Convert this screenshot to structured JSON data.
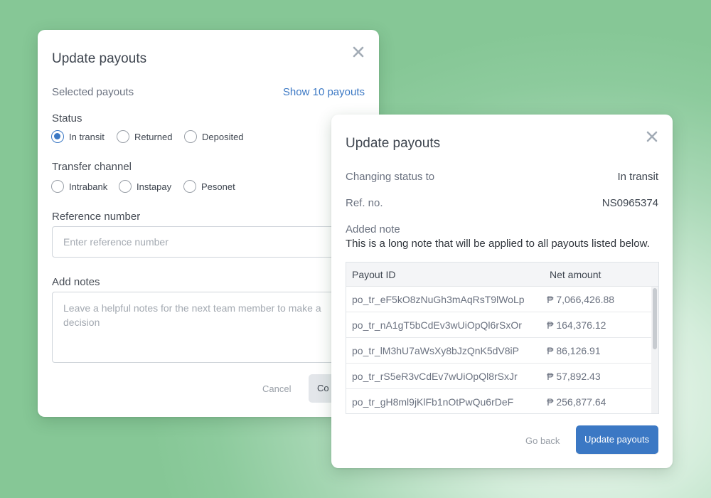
{
  "back_modal": {
    "title": "Update payouts",
    "selected_label": "Selected payouts",
    "show_link": "Show 10 payouts",
    "status_label": "Status",
    "status_options": [
      "In transit",
      "Returned",
      "Deposited"
    ],
    "status_selected": "In transit",
    "channel_label": "Transfer channel",
    "channel_options": [
      "Intrabank",
      "Instapay",
      "Pesonet"
    ],
    "reference_label": "Reference number",
    "reference_placeholder": "Enter reference number",
    "notes_label": "Add notes",
    "notes_placeholder": "Leave a helpful notes for the next team member to make a decision",
    "cancel_label": "Cancel",
    "confirm_label_visible": "Co"
  },
  "front_modal": {
    "title": "Update payouts",
    "changing_label": "Changing status to",
    "changing_value": "In transit",
    "ref_label": "Ref. no.",
    "ref_value": "NS0965374",
    "note_label": "Added note",
    "note_text": "This is a long note that will be applied to all payouts listed below.",
    "table": {
      "headers": [
        "Payout ID",
        "Net amount"
      ],
      "rows": [
        {
          "id": "po_tr_eF5kO8zNuGh3mAqRsT9lWoLp",
          "amount": "₱ 7,066,426.88"
        },
        {
          "id": "po_tr_nA1gT5bCdEv3wUiOpQl6rSxOr",
          "amount": "₱ 164,376.12"
        },
        {
          "id": "po_tr_lM3hU7aWsXy8bJzQnK5dV8iP",
          "amount": "₱ 86,126.91"
        },
        {
          "id": "po_tr_rS5eR3vCdEv7wUiOpQl8rSxJr",
          "amount": "₱ 57,892.43"
        },
        {
          "id": "po_tr_gH8ml9jKlFb1nOtPwQu6rDeF",
          "amount": "₱ 256,877.64"
        }
      ]
    },
    "go_back_label": "Go back",
    "update_label": "Update payouts"
  },
  "icons": {
    "close": "close-icon"
  },
  "colors": {
    "accent": "#3b78c4",
    "background": "#8dcb9d"
  }
}
